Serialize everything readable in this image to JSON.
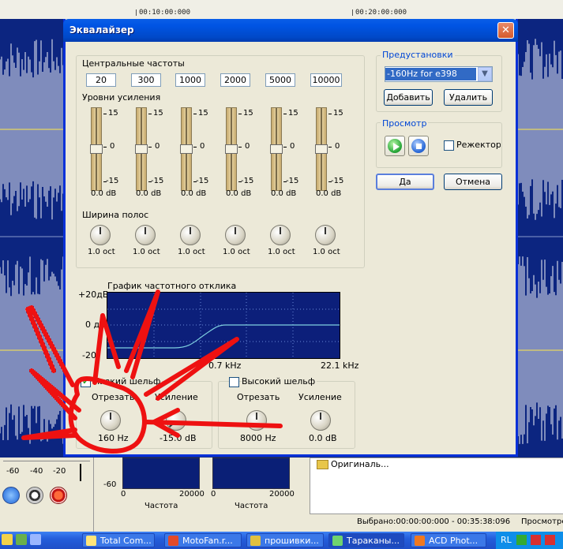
{
  "timeline": {
    "t1": "00:10:00:000",
    "t2": "00:20:00:000"
  },
  "dialog": {
    "title": "Эквалайзер",
    "close_glyph": "✕",
    "center_freqs_label": "Центральные частоты",
    "center_freqs": [
      "20",
      "300",
      "1000",
      "2000",
      "5000",
      "10000"
    ],
    "gain_levels_label": "Уровни усиления",
    "scale": {
      "top": "15",
      "mid": "0",
      "bottom": "-15"
    },
    "gains_db": [
      0,
      0,
      0,
      0,
      0,
      0
    ],
    "gain_labels": [
      "0.0 dB",
      "0.0 dB",
      "0.0 dB",
      "0.0 dB",
      "0.0 dB",
      "0.0 dB"
    ],
    "bandwidth_label": "Ширина полос",
    "bandwidths": [
      "1.0 oct",
      "1.0 oct",
      "1.0 oct",
      "1.0 oct",
      "1.0 oct",
      "1.0 oct"
    ],
    "presets": {
      "label": "Предустановки",
      "selected": "-160Hz for e398",
      "add_button": "Добавить",
      "delete_button": "Удалить"
    },
    "preview": {
      "label": "Просмотр",
      "reject_label": "Режектор",
      "reject_checked": false
    },
    "ok_button": "Да",
    "cancel_button": "Отмена",
    "graph": {
      "title": "График частотного отклика",
      "y_top": "+20дБ",
      "y_mid": "0 дБ",
      "y_bottom": "-20",
      "x_mid": "0.7 kHz",
      "x_end": "22.1 kHz"
    },
    "low_shelf": {
      "label": "Низкий шельф",
      "checked": true,
      "cut_label": "Отрезать",
      "gain_label": "Усиление",
      "cut_value": "160 Hz",
      "gain_value": "-15.0 dB"
    },
    "high_shelf": {
      "label": "Высокий шельф",
      "checked": false,
      "cut_label": "Отрезать",
      "gain_label": "Усиление",
      "cut_value": "8000 Hz",
      "gain_value": "0.0 dB"
    }
  },
  "bottom_panel": {
    "ruler": [
      "-60",
      "-40",
      "-20"
    ],
    "mini_charts": [
      {
        "y_label": "-60",
        "x_start": "0",
        "x_end": "20000",
        "xlabel": "Частота"
      },
      {
        "x_start": "0",
        "x_end": "20000",
        "xlabel": "Частота"
      }
    ],
    "file_item": "Оригиналь...",
    "status_selected": "Выбрано:00:00:00:000 - 00:35:38:096",
    "status_view": "Просмотре"
  },
  "taskbar": {
    "items": [
      "Total Com...",
      "MotoFan.r...",
      "прошивки...",
      "Тараканы...",
      "ACD Phot..."
    ],
    "lang": "RL"
  },
  "colors": {
    "titlebar": "#0054e3",
    "waveform_bg": "#0c2580",
    "graph_curve": "#7fd0e0",
    "annotation_red": "#ee1111"
  }
}
